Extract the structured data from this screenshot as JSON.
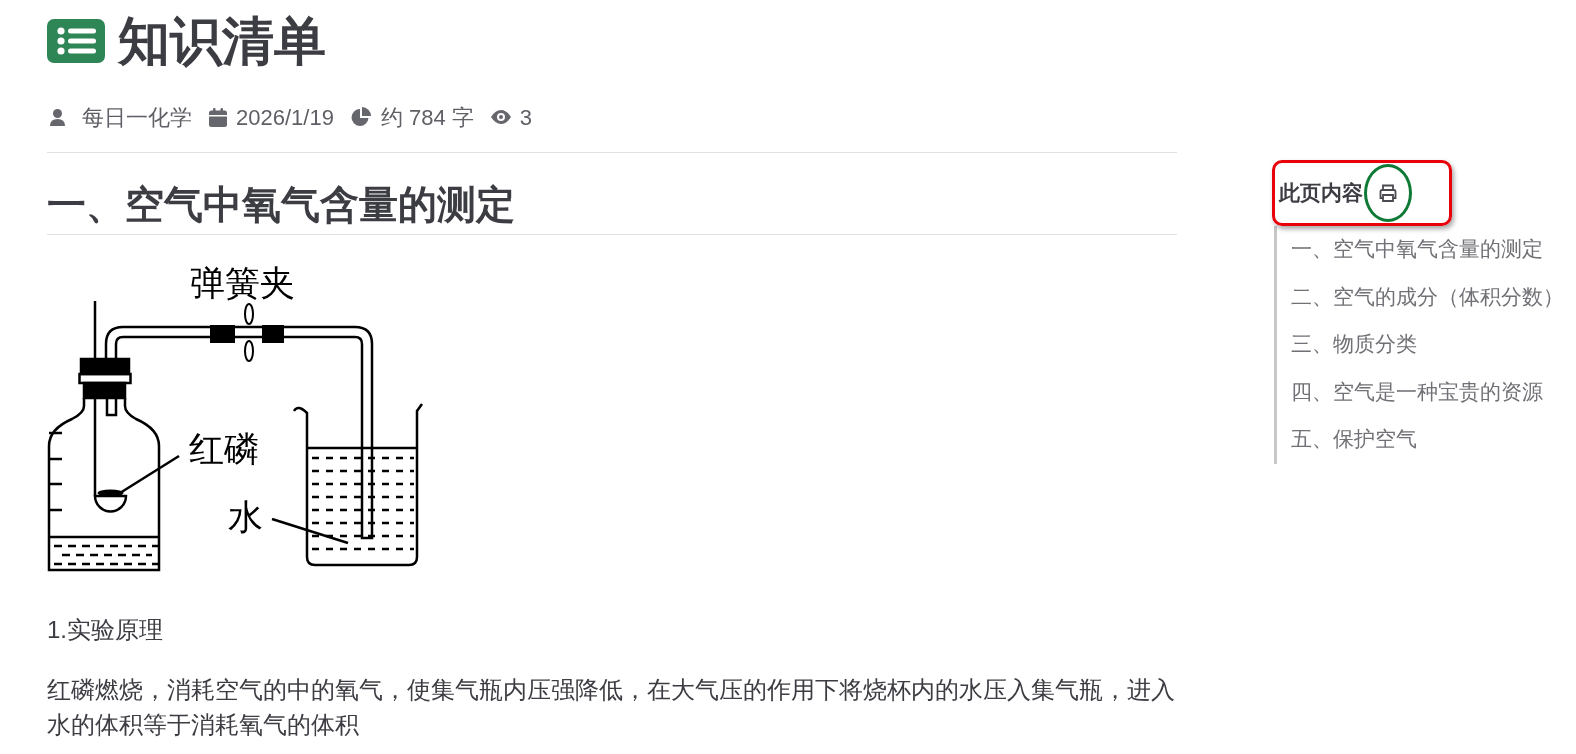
{
  "article": {
    "title": "知识清单",
    "meta": [
      {
        "kind": "author",
        "text": "每日一化学"
      },
      {
        "kind": "date",
        "text": "2026/1/19"
      },
      {
        "kind": "word_count",
        "text": "约 784 字"
      },
      {
        "kind": "views",
        "text": "3"
      }
    ],
    "section": {
      "heading": "一、空气中氧气含量的测定",
      "figure": {
        "clamp_label": "弹簧夹",
        "phosphorus_label": "红磷",
        "water_label": "水"
      },
      "paragraphs": [
        "1.实验原理",
        "红磷燃烧，消耗空气的中的氧气，使集气瓶内压强降低，在大气压的作用下将烧杯内的水压入集气瓶，进入水的体积等于消耗氧气的体积"
      ]
    }
  },
  "toc": {
    "title": "此页内容",
    "highlighted": true,
    "print_button": {
      "circled": true
    },
    "items": [
      "一、空气中氧气含量的测定",
      "二、空气的成分（体积分数）",
      "三、物质分类",
      "四、空气是一种宝贵的资源",
      "五、保护空气"
    ]
  }
}
